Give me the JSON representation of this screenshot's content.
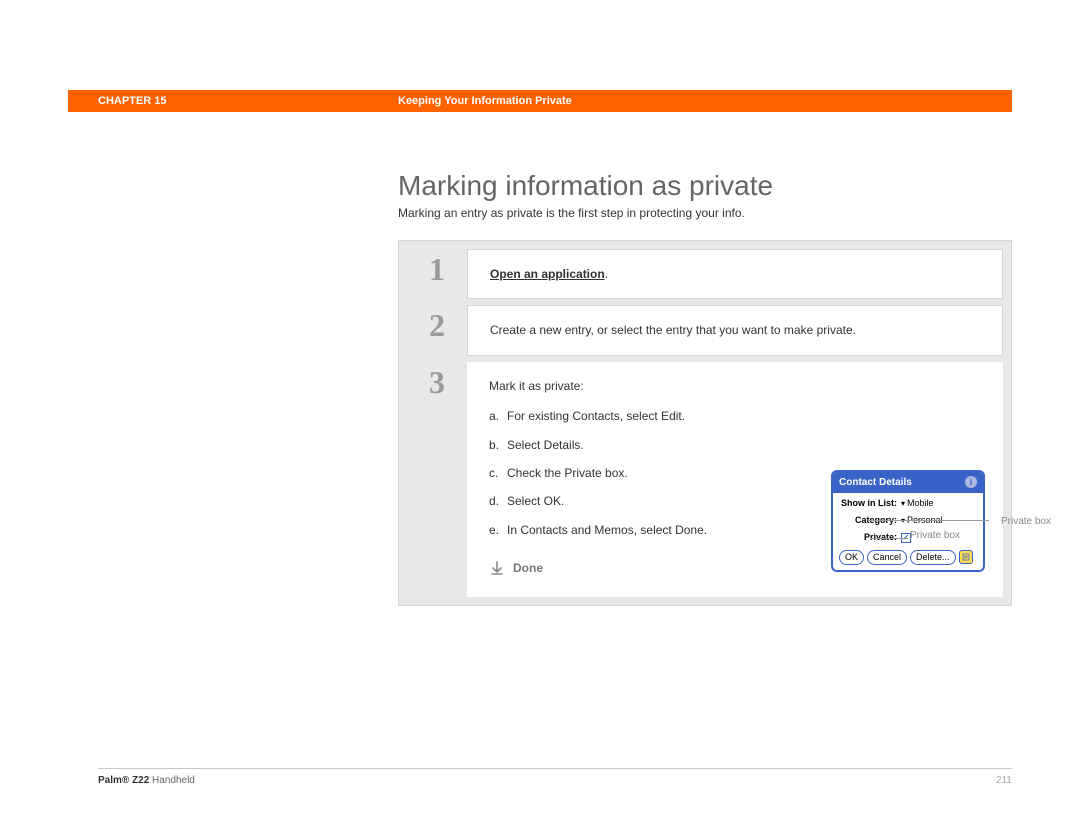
{
  "header": {
    "chapter": "CHAPTER 15",
    "title": "Keeping Your Information Private"
  },
  "main": {
    "title": "Marking information as private",
    "intro": "Marking an entry as private is the first step in protecting your info."
  },
  "steps": {
    "s1": {
      "num": "1",
      "link": "Open an application",
      "suffix": "."
    },
    "s2": {
      "num": "2",
      "text": "Create a new entry, or select the entry that you want to make private."
    },
    "s3": {
      "num": "3",
      "intro": "Mark it as private:",
      "a": {
        "letter": "a.",
        "text": "For existing Contacts, select Edit."
      },
      "b": {
        "letter": "b.",
        "text": "Select Details."
      },
      "c": {
        "letter": "c.",
        "text": "Check the Private box."
      },
      "d": {
        "letter": "d.",
        "text": "Select OK."
      },
      "e": {
        "letter": "e.",
        "text": "In Contacts and Memos, select Done."
      },
      "done": "Done"
    }
  },
  "dialog": {
    "title": "Contact Details",
    "show_label": "Show in List:",
    "show_val": "Mobile",
    "cat_label": "Category:",
    "cat_val": "Personal",
    "priv_label": "Private:",
    "check": "✓",
    "ok": "OK",
    "cancel": "Cancel",
    "delete": "Delete...",
    "info": "i"
  },
  "callout": "Private box",
  "footer": {
    "brand_bold": "Palm® Z22",
    "brand_rest": " Handheld",
    "page": "211"
  }
}
